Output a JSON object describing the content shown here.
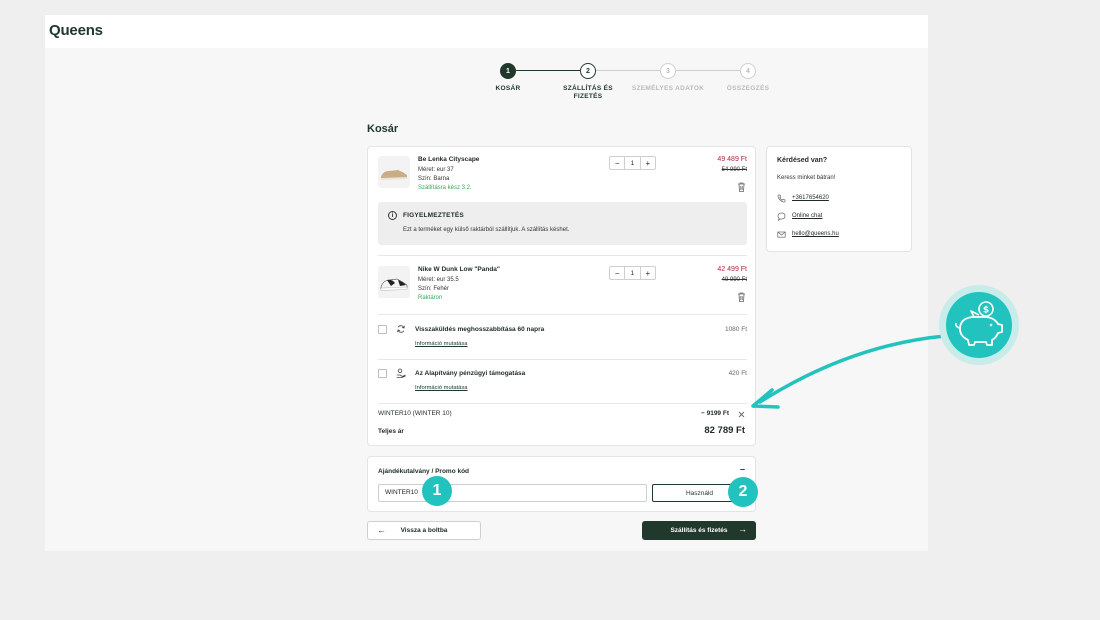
{
  "app": {
    "logo": "Queens"
  },
  "stepper": {
    "steps": [
      {
        "number": "1",
        "label": "KOSÁR",
        "state": "done"
      },
      {
        "number": "2",
        "label": "SZÁLLÍTÁS ÉS FIZETÉS",
        "state": "active"
      },
      {
        "number": "3",
        "label": "SZEMÉLYES ADATOK",
        "state": "inactive"
      },
      {
        "number": "4",
        "label": "ÖSSZEGZÉS",
        "state": "inactive"
      }
    ]
  },
  "page": {
    "title": "Kosár"
  },
  "cart": {
    "items": [
      {
        "name": "Be Lenka Cityscape",
        "size": "Méret: eur 37",
        "color": "Szín: Barna",
        "availability": "Szállításra kész 3.2.",
        "quantity": "1",
        "price": "49 489 Ft",
        "old_price": "54 990 Ft"
      },
      {
        "name": "Nike W Dunk Low \"Panda\"",
        "size": "Méret: eur 35.5",
        "color": "Szín: Fehér",
        "availability": "Raktáron",
        "quantity": "1",
        "price": "42 499 Ft",
        "old_price": "49 990 Ft"
      }
    ],
    "warning": {
      "title": "FIGYELMEZTETÉS",
      "text": "Ezt a terméket egy külső raktárból szállítjuk. A szállítás késhet."
    },
    "addons": [
      {
        "title": "Visszaküldés meghosszabbítása 60 napra",
        "link": "Információ mutatása",
        "price": "1080 Ft",
        "icon": "refresh-icon"
      },
      {
        "title": "Az Alapítvány pénzügyi támogatása",
        "link": "Információ mutatása",
        "price": "420 Ft",
        "icon": "donation-icon"
      }
    ],
    "discount": {
      "code": "WINTER10 (WINTER 10)",
      "amount": "− 9199 Ft"
    },
    "total": {
      "label": "Teljes ár",
      "value": "82 789 Ft"
    }
  },
  "promo": {
    "title": "Ajándékutalvány / Promo kód",
    "collapse": "–",
    "input_value": "WINTER10",
    "button": "Használd"
  },
  "nav": {
    "back": "Vissza a boltba",
    "next": "Szállítás és fizetés"
  },
  "help": {
    "title": "Kérdésed van?",
    "subtitle": "Keress minket bátran!",
    "phone": "+3617654620",
    "chat": "Online chat",
    "email": "hello@queens.hu"
  },
  "annotations": {
    "badge1": "1",
    "badge2": "2"
  },
  "colors": {
    "brand": "#21382c",
    "accent": "#22c3be",
    "price_red": "#b3263c",
    "green": "#3aa65a"
  }
}
